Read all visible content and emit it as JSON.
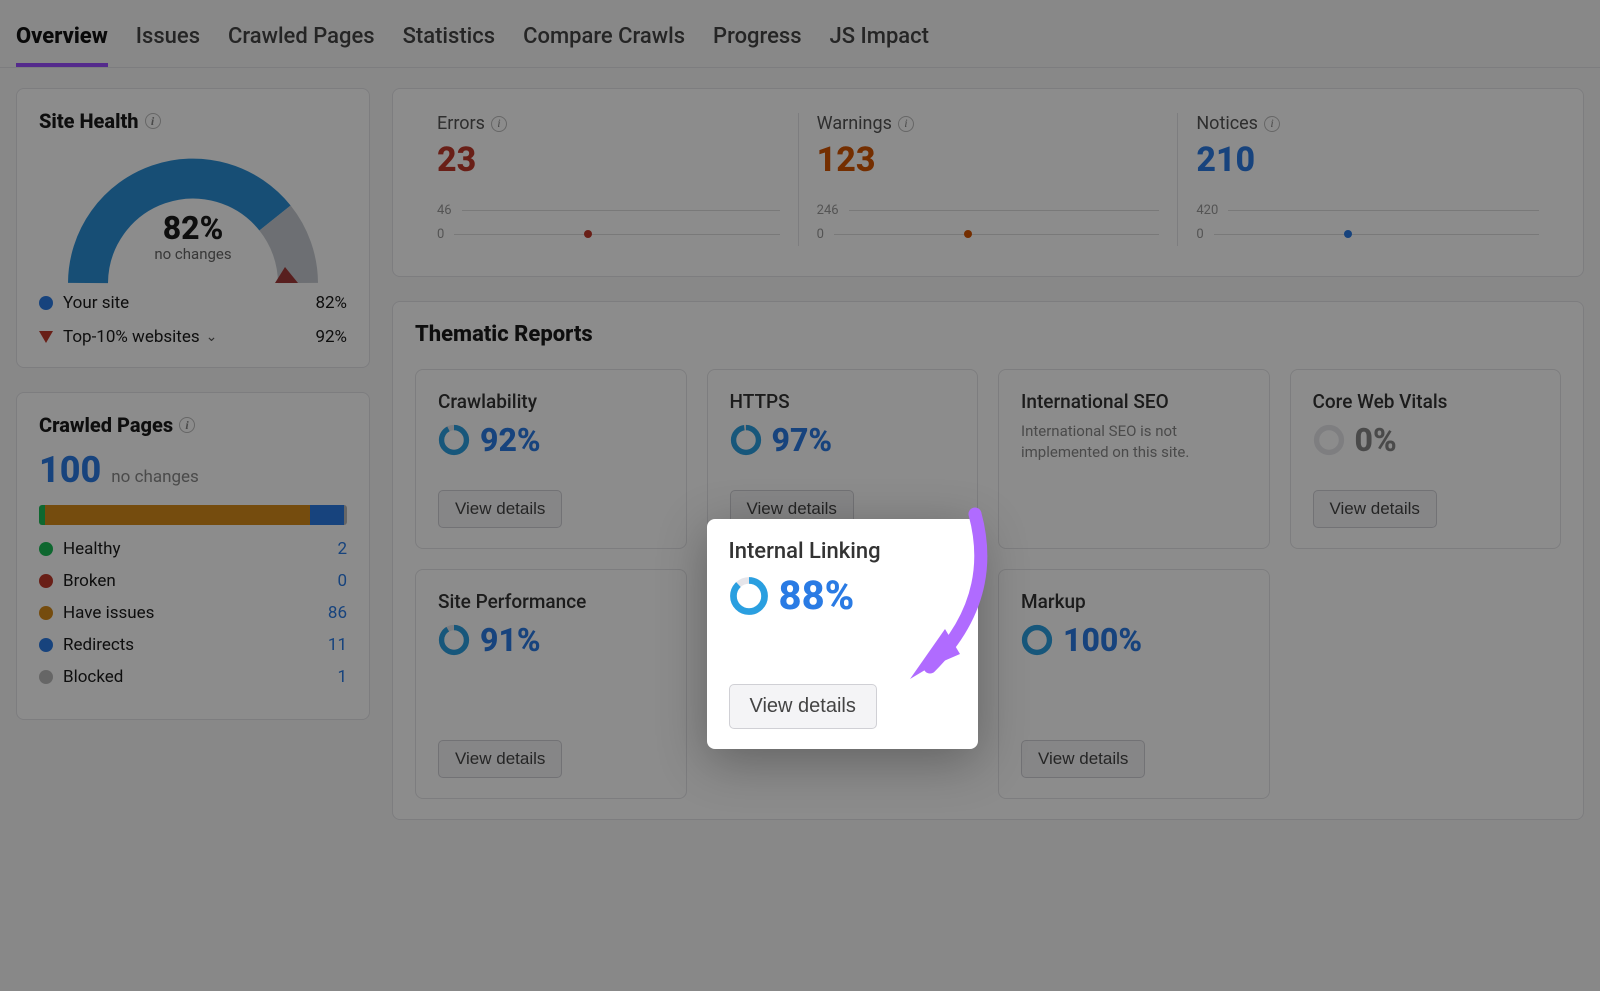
{
  "tabs": [
    "Overview",
    "Issues",
    "Crawled Pages",
    "Statistics",
    "Compare Crawls",
    "Progress",
    "JS Impact"
  ],
  "active_tab": 0,
  "site_health": {
    "title": "Site Health",
    "percent": "82%",
    "sub": "no changes",
    "legend": [
      {
        "label": "Your site",
        "value": "82%",
        "color": "#2a7be4",
        "shape": "dot"
      },
      {
        "label": "Top-10% websites",
        "value": "92%",
        "color": "#c0392b",
        "shape": "tri",
        "expandable": true
      }
    ]
  },
  "crawled_pages": {
    "title": "Crawled Pages",
    "total": "100",
    "note": "no changes",
    "segments": [
      {
        "color": "#1abc57",
        "pct": 2
      },
      {
        "color": "#d68b1a",
        "pct": 86
      },
      {
        "color": "#2a7be4",
        "pct": 11
      },
      {
        "color": "#bbb",
        "pct": 1
      }
    ],
    "rows": [
      {
        "label": "Healthy",
        "value": "2",
        "color": "#1abc57"
      },
      {
        "label": "Broken",
        "value": "0",
        "color": "#c0392b"
      },
      {
        "label": "Have issues",
        "value": "86",
        "color": "#d68b1a"
      },
      {
        "label": "Redirects",
        "value": "11",
        "color": "#2a7be4"
      },
      {
        "label": "Blocked",
        "value": "1",
        "color": "#bbb"
      }
    ]
  },
  "stats": {
    "errors": {
      "title": "Errors",
      "value": "23",
      "axis_top": "46",
      "axis_bot": "0",
      "dot": "#c0392b"
    },
    "warnings": {
      "title": "Warnings",
      "value": "123",
      "axis_top": "246",
      "axis_bot": "0",
      "dot": "#d35400"
    },
    "notices": {
      "title": "Notices",
      "value": "210",
      "axis_top": "420",
      "axis_bot": "0",
      "dot": "#2a7be4"
    }
  },
  "thematic": {
    "title": "Thematic Reports",
    "button": "View details",
    "reports": [
      {
        "title": "Crawlability",
        "pct": "92%",
        "pctNum": 92,
        "btn": true
      },
      {
        "title": "HTTPS",
        "pct": "97%",
        "pctNum": 97,
        "btn": true
      },
      {
        "title": "International SEO",
        "note": "International SEO is not implemented on this site."
      },
      {
        "title": "Core Web Vitals",
        "pct": "0%",
        "pctNum": 0,
        "btn": true,
        "zero": true
      },
      {
        "title": "Site Performance",
        "pct": "91%",
        "pctNum": 91,
        "btn": true
      },
      {
        "title": "Internal Linking",
        "pct": "88%",
        "pctNum": 88,
        "btn": true,
        "highlight": true
      },
      {
        "title": "Markup",
        "pct": "100%",
        "pctNum": 100,
        "btn": true
      }
    ]
  }
}
